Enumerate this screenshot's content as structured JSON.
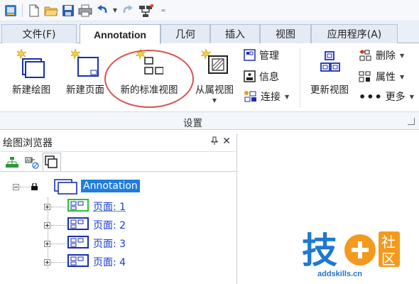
{
  "qat": {
    "icons": [
      "app-menu-icon",
      "new-icon",
      "open-icon",
      "save-icon",
      "print-icon",
      "undo-icon",
      "redo-icon",
      "custom-tools-icon"
    ],
    "overflow": "="
  },
  "tabs": [
    {
      "label": "文件(F)",
      "active": false
    },
    {
      "label": "Annotation",
      "active": true
    },
    {
      "label": "几何",
      "active": false
    },
    {
      "label": "插入",
      "active": false
    },
    {
      "label": "视图",
      "active": false
    },
    {
      "label": "应用程序(A)",
      "active": false
    }
  ],
  "ribbon": {
    "new_drawing": "新建绘图",
    "new_page": "新建页面",
    "new_standard_view": "新的标准视图",
    "projection_view": "从属视图",
    "manage": "管理",
    "info": "信息",
    "connect": "连接",
    "update_view": "更新视图",
    "delete": "删除",
    "properties": "属性",
    "more": "更多",
    "group_label": "设置"
  },
  "panel": {
    "title": "绘图浏览器",
    "pin": "ᵖ",
    "close": "✕",
    "tree": {
      "root": "Annotation",
      "pages": [
        "页面: 1",
        "页面: 2",
        "页面: 3",
        "页面: 4"
      ]
    }
  },
  "watermark": {
    "char1": "技",
    "char2": "社",
    "char3": "区",
    "url": "addskills.cn"
  },
  "colors": {
    "accent": "#1e7de0",
    "highlight": "#d9534f",
    "page_text": "#1b3bd6"
  }
}
